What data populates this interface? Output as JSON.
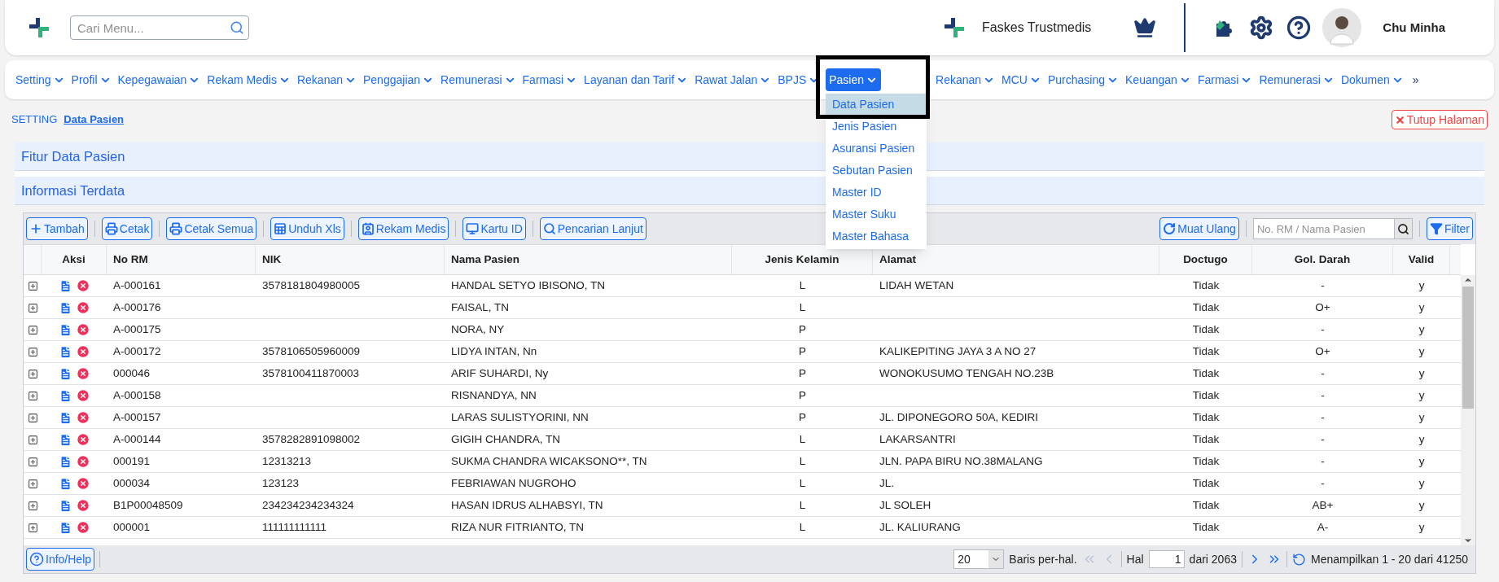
{
  "header": {
    "search": {
      "placeholder": "Cari Menu..."
    },
    "facility": "Faskes Trustmedis",
    "user": "Chu Minha"
  },
  "nav": [
    {
      "label": "Setting",
      "selected": false
    },
    {
      "label": "Profil",
      "selected": false
    },
    {
      "label": "Kepegawaian",
      "selected": false
    },
    {
      "label": "Rekam Medis",
      "selected": false
    },
    {
      "label": "Rekanan",
      "selected": false
    },
    {
      "label": "Penggajian",
      "selected": false
    },
    {
      "label": "Remunerasi",
      "selected": false
    },
    {
      "label": "Farmasi",
      "selected": false
    },
    {
      "label": "Layanan dan Tarif",
      "selected": false
    },
    {
      "label": "Rawat Jalan",
      "selected": false
    },
    {
      "label": "BPJS",
      "selected": false
    },
    {
      "label": "Pasien",
      "selected": true
    },
    {
      "label": "Rekanan",
      "selected": false
    },
    {
      "label": "MCU",
      "selected": false
    },
    {
      "label": "Purchasing",
      "selected": false
    },
    {
      "label": "Keuangan",
      "selected": false
    },
    {
      "label": "Farmasi",
      "selected": false
    },
    {
      "label": "Remunerasi",
      "selected": false
    },
    {
      "label": "Dokumen",
      "selected": false
    }
  ],
  "nav_more": "»",
  "dropdown": [
    {
      "label": "Data Pasien",
      "selected": true
    },
    {
      "label": "Jenis Pasien",
      "selected": false
    },
    {
      "label": "Asuransi Pasien",
      "selected": false
    },
    {
      "label": "Sebutan Pasien",
      "selected": false
    },
    {
      "label": "Master ID",
      "selected": false
    },
    {
      "label": "Master Suku",
      "selected": false
    },
    {
      "label": "Master Bahasa",
      "selected": false
    }
  ],
  "breadcrumb": {
    "section": "SETTING",
    "page": "Data Pasien"
  },
  "close_button": "Tutup Halaman",
  "panels": [
    "Fitur Data Pasien",
    "Informasi Terdata"
  ],
  "toolbar": [
    {
      "kind": "add",
      "label": "Tambah"
    },
    {
      "kind": "print",
      "label": "Cetak"
    },
    {
      "kind": "print",
      "label": "Cetak Semua"
    },
    {
      "kind": "download",
      "label": "Unduh Xls"
    },
    {
      "kind": "record",
      "label": "Rekam Medis"
    },
    {
      "kind": "card",
      "label": "Kartu ID"
    },
    {
      "kind": "search",
      "label": "Pencarian Lanjut"
    }
  ],
  "reload_button": "Muat Ulang",
  "table_search": {
    "placeholder": "No. RM / Nama Pasien"
  },
  "filter_button": "Filter",
  "table": {
    "columns": [
      "Aksi",
      "No RM",
      "NIK",
      "Nama Pasien",
      "Jenis Kelamin",
      "Alamat",
      "Doctugo",
      "Gol. Darah",
      "Valid"
    ],
    "rows": [
      [
        "",
        "A-000161",
        "3578181804980005",
        "HANDAL SETYO IBISONO, TN",
        "L",
        "LIDAH WETAN",
        "Tidak",
        "-",
        "y"
      ],
      [
        "",
        "A-000176",
        "",
        "FAISAL, TN",
        "L",
        "",
        "Tidak",
        "O+",
        "y"
      ],
      [
        "",
        "A-000175",
        "",
        "NORA, NY",
        "P",
        "",
        "Tidak",
        "-",
        "y"
      ],
      [
        "",
        "A-000172",
        "3578106505960009",
        "LIDYA INTAN, Nn",
        "P",
        "KALIKEPITING JAYA 3 A NO 27",
        "Tidak",
        "O+",
        "y"
      ],
      [
        "",
        "000046",
        "3578100411870003",
        "ARIF SUHARDI, Ny",
        "P",
        "WONOKUSUMO TENGAH NO.23B",
        "Tidak",
        "-",
        "y"
      ],
      [
        "",
        "A-000158",
        "",
        "RISNANDYA, NN",
        "P",
        "",
        "Tidak",
        "-",
        "y"
      ],
      [
        "",
        "A-000157",
        "",
        "LARAS SULISTYORINI, NN",
        "P",
        "JL. DIPONEGORO 50A, KEDIRI",
        "Tidak",
        "-",
        "y"
      ],
      [
        "",
        "A-000144",
        "3578282891098002",
        "GIGIH CHANDRA, TN",
        "L",
        "LAKARSANTRI",
        "Tidak",
        "-",
        "y"
      ],
      [
        "",
        "000191",
        "12313213",
        "SUKMA CHANDRA WICAKSONO**, TN",
        "L",
        "JLN. PAPA BIRU NO.38MALANG",
        "Tidak",
        "-",
        "y"
      ],
      [
        "",
        "000034",
        "123123",
        "FEBRIAWAN NUGROHO",
        "L",
        "JL.",
        "Tidak",
        "-",
        "y"
      ],
      [
        "",
        "B1P00048509",
        "234234234234324",
        "HASAN IDRUS ALHABSYI, TN",
        "L",
        "JL SOLEH",
        "Tidak",
        "AB+",
        "y"
      ],
      [
        "",
        "000001",
        "111111111111",
        "RIZA NUR FITRIANTO, TN",
        "L",
        "JL. KALIURANG",
        "Tidak",
        "A-",
        "y"
      ]
    ]
  },
  "footer": {
    "help": "Info/Help",
    "page_size": "20",
    "page_size_label": "Baris per-hal.",
    "page_label": "Hal",
    "page": "1",
    "page_total": "dari 2063",
    "summary": "Menampilkan 1 - 20 dari 41250"
  }
}
